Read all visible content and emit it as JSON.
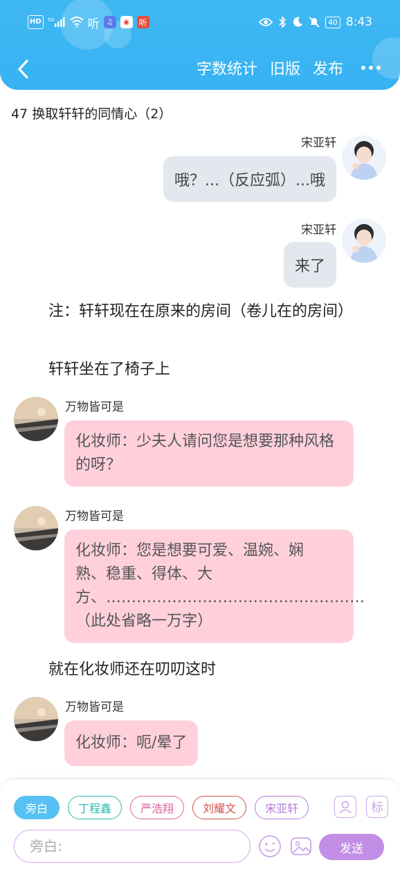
{
  "status_bar": {
    "hd_label": "HD",
    "network_label": "5G",
    "app_ting_1": "听",
    "app_ting_2": "听",
    "battery": "40",
    "time": "8:43"
  },
  "nav": {
    "word_count": "字数统计",
    "old_version": "旧版",
    "publish": "发布"
  },
  "chapter_title": "47 换取轩轩的同情心（2）",
  "messages": [
    {
      "name": "宋亚轩",
      "text": "哦？...（反应弧）...哦"
    },
    {
      "name": "宋亚轩",
      "text": "来了"
    }
  ],
  "narrations": [
    "注：轩轩现在在原来的房间（卷儿在的房间）",
    "轩轩坐在了椅子上",
    "就在化妆师还在叨叨这时"
  ],
  "left_messages": [
    {
      "name": "万物皆可是",
      "text": "化妆师：少夫人请问您是想要那种风格的呀？"
    },
    {
      "name": "万物皆可是",
      "text": "化妆师：您是想要可爱、温婉、娴熟、稳重、得体、大方、……………………………………………（此处省略一万字）"
    },
    {
      "name": "万物皆可是",
      "text": "化妆师：呃/晕了"
    }
  ],
  "input_panel": {
    "roles": [
      {
        "label": "旁白",
        "color": "#56c1f2"
      },
      {
        "label": "丁程鑫",
        "color": "#2bb7b0"
      },
      {
        "label": "严浩翔",
        "color": "#d9629c"
      },
      {
        "label": "刘耀文",
        "color": "#d4524a"
      },
      {
        "label": "宋亚轩",
        "color": "#b07ad9"
      }
    ],
    "tag_icon_label": "标",
    "placeholder": "旁白:",
    "send_label": "发送"
  }
}
